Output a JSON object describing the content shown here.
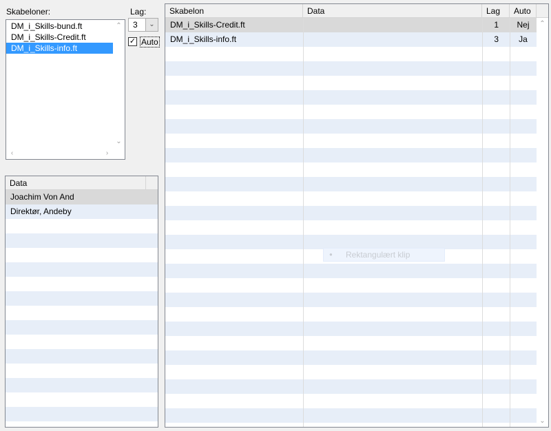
{
  "templates_label": "Skabeloner:",
  "templates": [
    "DM_i_Skills-bund.ft",
    "DM_i_Skills-Credit.ft",
    "DM_i_Skills-info.ft"
  ],
  "selected_template_index": 2,
  "layer_label": "Lag:",
  "layer_value": "3",
  "auto_label": "Auto",
  "auto_checked": true,
  "data_table": {
    "header": "Data",
    "rows": [
      "Joachim Von And",
      "Direktør, Andeby"
    ]
  },
  "main_table": {
    "headers": {
      "template": "Skabelon",
      "data": "Data",
      "layer": "Lag",
      "auto": "Auto"
    },
    "rows": [
      {
        "template": "DM_i_Skills-Credit.ft",
        "data": "",
        "layer": "1",
        "auto": "Nej"
      },
      {
        "template": "DM_i_Skills-info.ft",
        "data": "",
        "layer": "3",
        "auto": "Ja"
      }
    ]
  },
  "ghost_menu_item": "Rektangulært klip",
  "colors": {
    "selection": "#3399ff",
    "row_alt": "#e7eef8",
    "row_selected": "#d9d9d9"
  }
}
